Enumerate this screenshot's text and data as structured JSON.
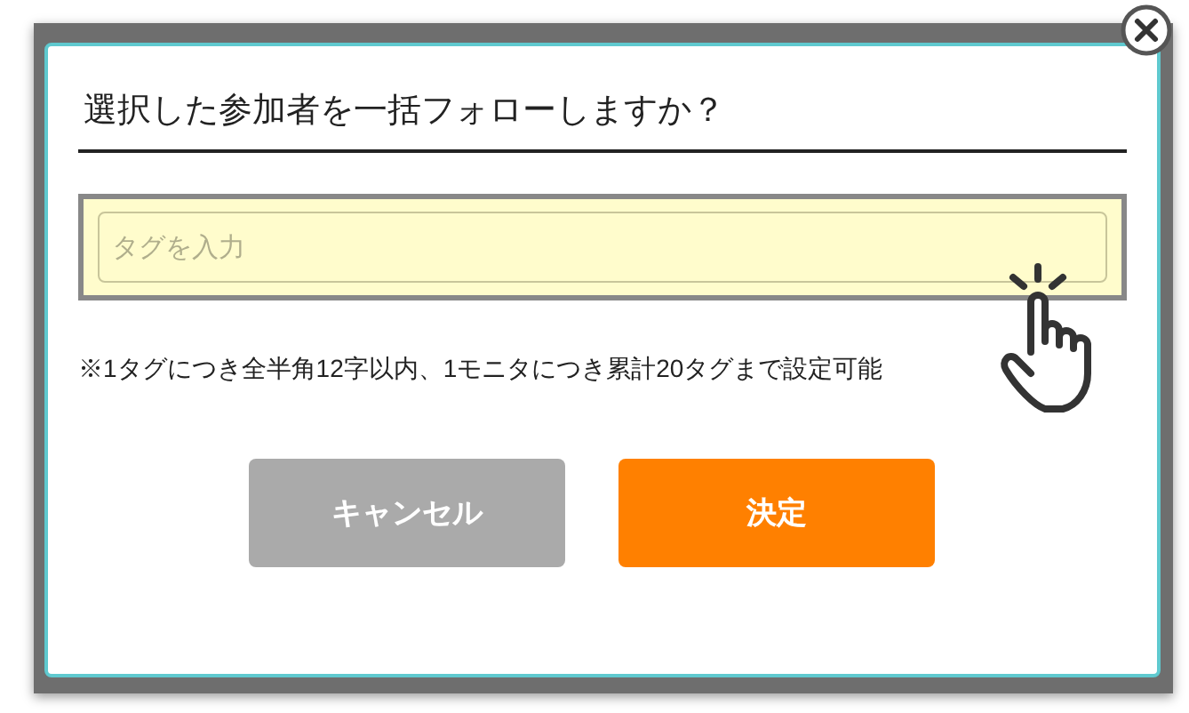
{
  "dialog": {
    "title": "選択した参加者を一括フォローしますか？",
    "tag_field": {
      "placeholder": "タグを入力"
    },
    "note": "※1タグにつき全半角12字以内、1モニタにつき累計20タグまで設定可能",
    "buttons": [
      {
        "label": "キャンセル",
        "kind": "cancel"
      },
      {
        "label": "決定",
        "kind": "confirm"
      }
    ]
  }
}
